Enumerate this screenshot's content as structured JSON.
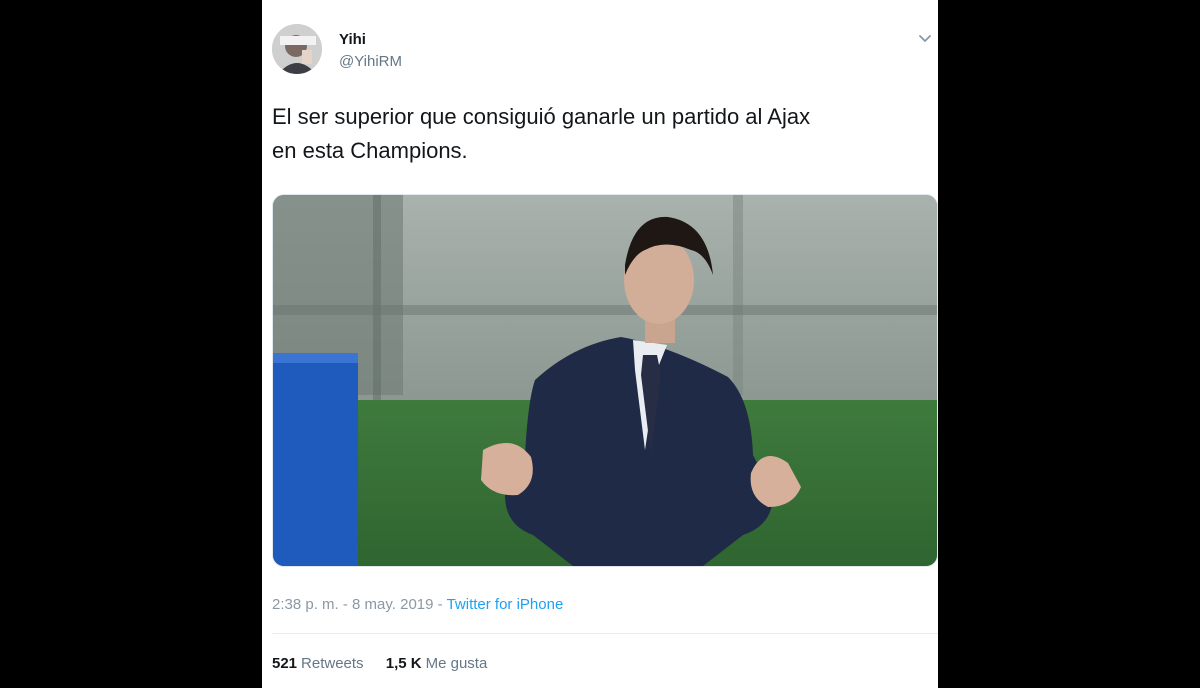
{
  "tweet": {
    "display_name": "Yihi",
    "handle": "@YihiRM",
    "text_line1": "El ser superior que consiguió ganarle un partido al Ajax",
    "text_line2": "en esta Champions.",
    "time": "2:38 p. m.",
    "separator": " - ",
    "date": "8 may. 2019",
    "source": "Twitter for iPhone"
  },
  "stats": {
    "retweets_count": "521",
    "retweets_label": "Retweets",
    "likes_count": "1,5 K",
    "likes_label": "Me gusta"
  },
  "icons": {
    "menu": "chevron-down-icon"
  },
  "colors": {
    "link": "#1da1f2",
    "muted": "#657786",
    "text": "#14171a"
  }
}
